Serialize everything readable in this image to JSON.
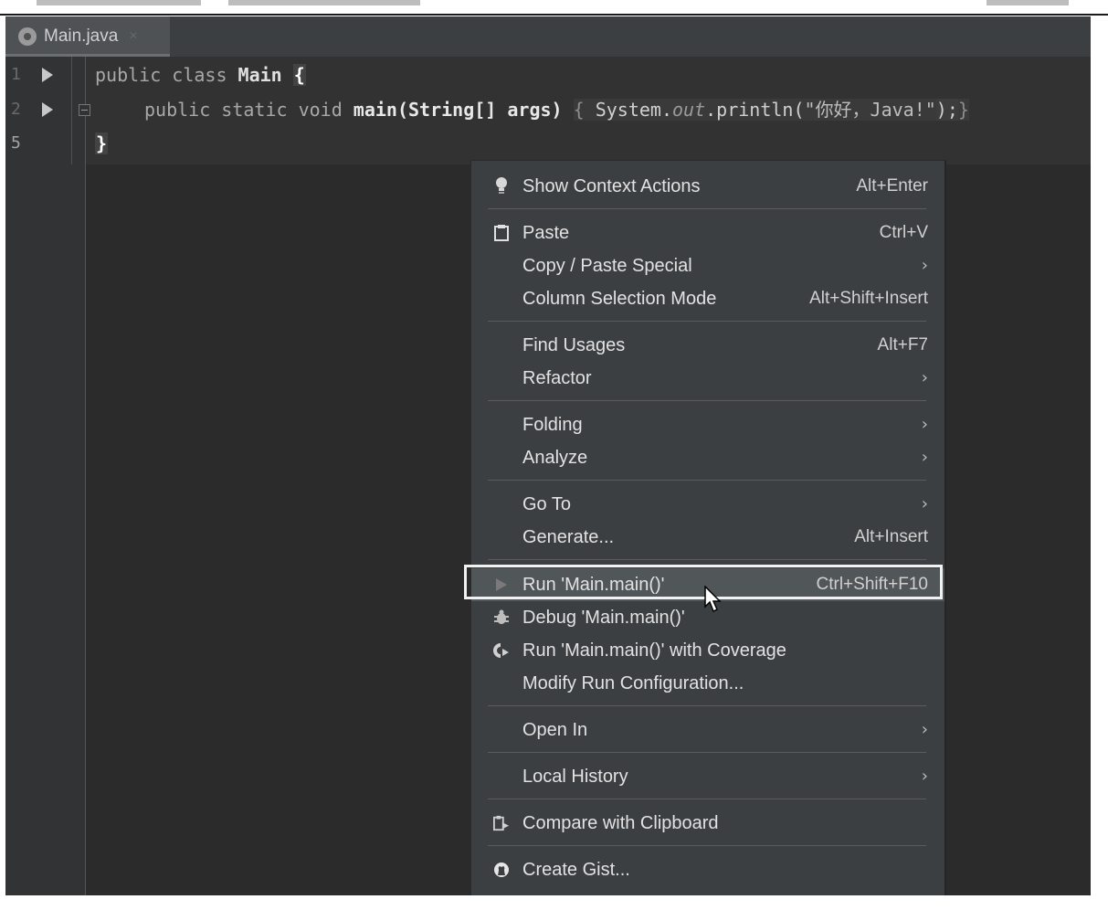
{
  "editor": {
    "tab": {
      "title": "Main.java",
      "icon": "java-class-icon",
      "close_glyph": "×"
    },
    "lines": [
      {
        "number": "1",
        "code": "public class Main {"
      },
      {
        "number": "2",
        "code": "public static void main(String[] args) { System.out.println(\"你好，Java!\"); }"
      },
      {
        "number": "5",
        "code": "}"
      }
    ],
    "code_tokens": {
      "line1_kw": "public class ",
      "line1_cls": "Main",
      "line1_brace": "{",
      "line2_kw": "public static void ",
      "line2_fn": "main",
      "line2_args": "(String[] args) ",
      "line2_lbrace": "{",
      "line2_sys": " System.",
      "line2_out": "out",
      "line2_print": ".println(",
      "line2_str": "\"你好，Java!\"",
      "line2_close": ");",
      "line2_rbrace": "}",
      "line3_brace": "}"
    }
  },
  "context_menu": {
    "groups": [
      [
        {
          "label": "Show Context Actions",
          "shortcut": "Alt+Enter",
          "icon": "lightbulb-icon"
        }
      ],
      [
        {
          "label": "Paste",
          "shortcut": "Ctrl+V",
          "icon": "clipboard-icon"
        },
        {
          "label": "Copy / Paste Special",
          "submenu": true
        },
        {
          "label": "Column Selection Mode",
          "shortcut": "Alt+Shift+Insert"
        }
      ],
      [
        {
          "label": "Find Usages",
          "shortcut": "Alt+F7"
        },
        {
          "label": "Refactor",
          "submenu": true
        }
      ],
      [
        {
          "label": "Folding",
          "submenu": true
        },
        {
          "label": "Analyze",
          "submenu": true
        }
      ],
      [
        {
          "label": "Go To",
          "submenu": true
        },
        {
          "label": "Generate...",
          "shortcut": "Alt+Insert"
        }
      ],
      [
        {
          "label": "Run 'Main.main()'",
          "shortcut": "Ctrl+Shift+F10",
          "icon": "run-icon",
          "highlighted": true
        },
        {
          "label": "Debug 'Main.main()'",
          "icon": "bug-icon"
        },
        {
          "label": "Run 'Main.main()' with Coverage",
          "icon": "coverage-icon"
        },
        {
          "label": "Modify Run Configuration..."
        }
      ],
      [
        {
          "label": "Open In",
          "submenu": true
        }
      ],
      [
        {
          "label": "Local History",
          "submenu": true
        }
      ],
      [
        {
          "label": "Compare with Clipboard",
          "icon": "compare-clipboard-icon"
        }
      ],
      [
        {
          "label": "Create Gist...",
          "icon": "github-icon"
        }
      ]
    ],
    "submenu_glyph": "›"
  },
  "colors": {
    "editor_bg": "#2b2b2b",
    "menu_bg": "#3c3f41",
    "highlight_frame": "#f2f2f2"
  }
}
